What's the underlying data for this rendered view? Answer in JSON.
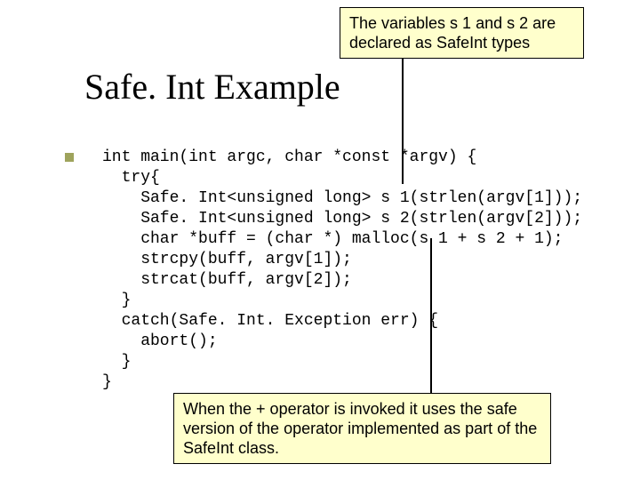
{
  "title": "Safe. Int Example",
  "callouts": {
    "top": "The variables s 1 and s 2 are declared as SafeInt types",
    "bottom": "When the + operator is invoked it uses the safe version of the operator implemented as part of the SafeInt class."
  },
  "code": "int main(int argc, char *const *argv) {\n  try{\n    Safe. Int<unsigned long> s 1(strlen(argv[1]));\n    Safe. Int<unsigned long> s 2(strlen(argv[2]));\n    char *buff = (char *) malloc(s 1 + s 2 + 1);\n    strcpy(buff, argv[1]);\n    strcat(buff, argv[2]);\n  }\n  catch(Safe. Int. Exception err) {\n    abort();\n  }\n}"
}
